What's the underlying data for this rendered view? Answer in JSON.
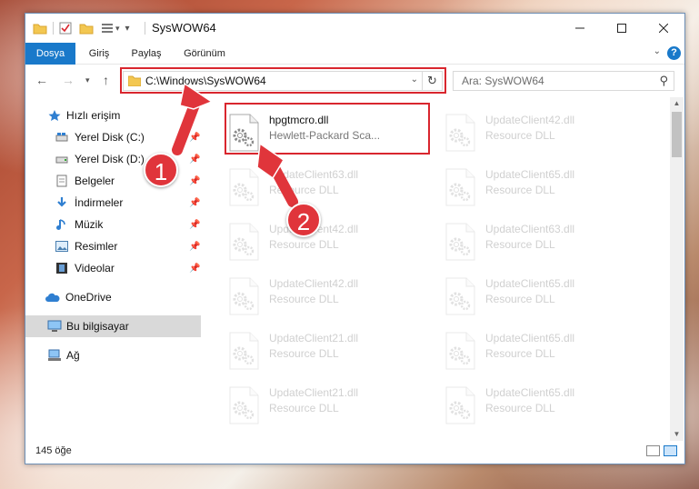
{
  "window": {
    "title": "SysWOW64"
  },
  "ribbon": {
    "tabs": [
      "Dosya",
      "Giriş",
      "Paylaş",
      "Görünüm"
    ],
    "help": "?"
  },
  "nav": {
    "address": "C:\\Windows\\SysWOW64",
    "search_placeholder": "Ara: SysWOW64"
  },
  "sidebar": {
    "items": [
      {
        "label": "Hızlı erişim",
        "icon": "star-icon"
      },
      {
        "label": "Yerel Disk (C:)",
        "icon": "drive-icon"
      },
      {
        "label": "Yerel Disk (D:)",
        "icon": "drive-icon"
      },
      {
        "label": "Belgeler",
        "icon": "documents-icon"
      },
      {
        "label": "İndirmeler",
        "icon": "download-icon"
      },
      {
        "label": "Müzik",
        "icon": "music-icon"
      },
      {
        "label": "Resimler",
        "icon": "pictures-icon"
      },
      {
        "label": "Videolar",
        "icon": "videos-icon"
      },
      {
        "label": "OneDrive",
        "icon": "cloud-icon"
      },
      {
        "label": "Bu bilgisayar",
        "icon": "computer-icon"
      },
      {
        "label": "Ağ",
        "icon": "network-icon"
      }
    ]
  },
  "files": [
    {
      "name": "hpgtmcro.dll",
      "desc": "Hewlett-Packard Sca..."
    },
    {
      "name": "UpdateClient42.dll",
      "desc": "Resource DLL"
    },
    {
      "name": "UpdateClient63.dll",
      "desc": "Resource DLL"
    },
    {
      "name": "UpdateClient65.dll",
      "desc": "Resource DLL"
    },
    {
      "name": "UpdateClient42.dll",
      "desc": "Resource DLL"
    },
    {
      "name": "UpdateClient63.dll",
      "desc": "Resource DLL"
    },
    {
      "name": "UpdateClient42.dll",
      "desc": "Resource DLL"
    },
    {
      "name": "UpdateClient65.dll",
      "desc": "Resource DLL"
    },
    {
      "name": "UpdateClient21.dll",
      "desc": "Resource DLL"
    },
    {
      "name": "UpdateClient65.dll",
      "desc": "Resource DLL"
    },
    {
      "name": "UpdateClient21.dll",
      "desc": "Resource DLL"
    },
    {
      "name": "UpdateClient65.dll",
      "desc": "Resource DLL"
    }
  ],
  "status": {
    "count": "145 öğe"
  },
  "callouts": [
    "1",
    "2"
  ],
  "colors": {
    "accent": "#1979ca",
    "highlight": "#d9262e"
  }
}
